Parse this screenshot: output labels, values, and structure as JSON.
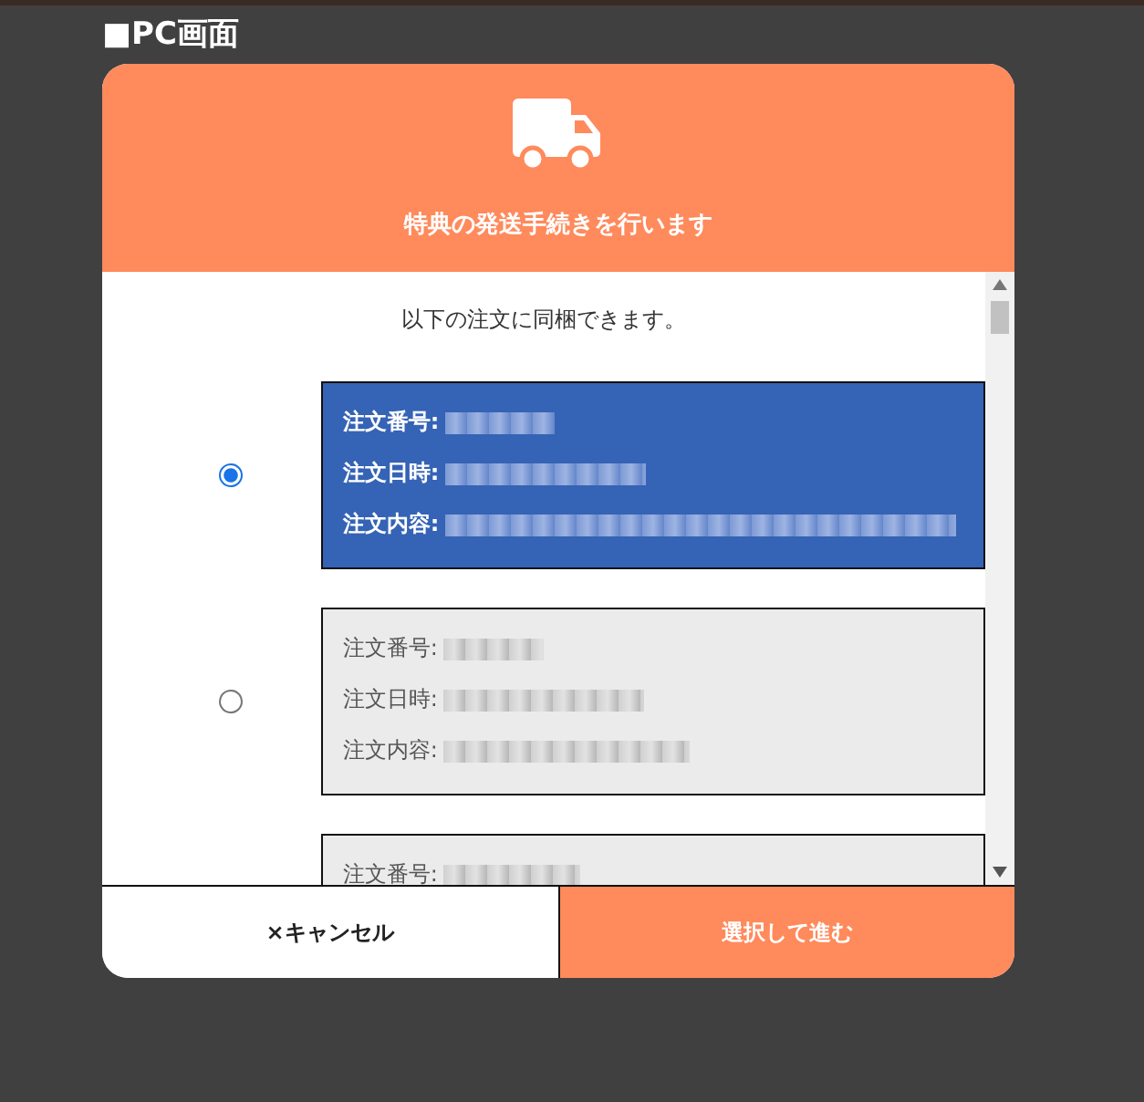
{
  "page_heading": "■PC画面",
  "dialog": {
    "title": "特典の発送手続きを行います",
    "intro": "以下の注文に同梱できます。",
    "orders": [
      {
        "selected": true,
        "fields": [
          "注文番号:",
          "注文日時:",
          "注文内容:"
        ]
      },
      {
        "selected": false,
        "fields": [
          "注文番号:",
          "注文日時:",
          "注文内容:"
        ]
      },
      {
        "selected": false,
        "fields": [
          "注文番号:"
        ]
      }
    ],
    "buttons": [
      {
        "kind": "cancel",
        "label": "×キャンセル"
      },
      {
        "kind": "primary",
        "label": "選択して進む"
      }
    ]
  }
}
